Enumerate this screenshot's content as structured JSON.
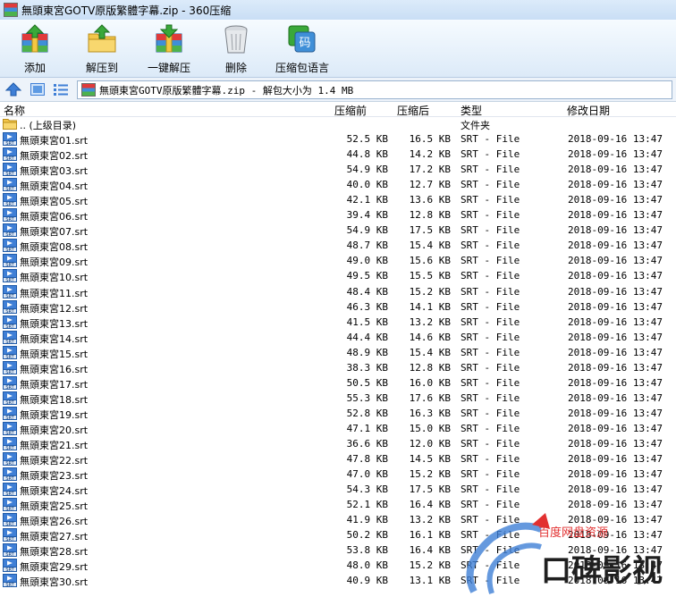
{
  "window": {
    "title": "無頭東宮GOTV原版繁體字幕.zip - 360压缩"
  },
  "toolbar": {
    "add_label": "添加",
    "extract_to_label": "解压到",
    "one_click_extract_label": "一键解压",
    "delete_label": "删除",
    "language_label": "压缩包语言",
    "language_icon_glyph": "码"
  },
  "address": {
    "path": "無頭東宮GOTV原版繁體字幕.zip - 解包大小为 1.4 MB"
  },
  "columns": {
    "name": "名称",
    "compressed_before": "压缩前",
    "compressed_after": "压缩后",
    "type": "类型",
    "modified": "修改日期"
  },
  "parent_row": {
    "name": ".. (上级目录)",
    "type": "文件夹"
  },
  "icons": {
    "srt_label": "SRT"
  },
  "files": [
    {
      "name": "無頭東宮01.srt",
      "before": "52.5 KB",
      "after": "16.5 KB",
      "type": "SRT - File",
      "date": "2018-09-16 13:47"
    },
    {
      "name": "無頭東宮02.srt",
      "before": "44.8 KB",
      "after": "14.2 KB",
      "type": "SRT - File",
      "date": "2018-09-16 13:47"
    },
    {
      "name": "無頭東宮03.srt",
      "before": "54.9 KB",
      "after": "17.2 KB",
      "type": "SRT - File",
      "date": "2018-09-16 13:47"
    },
    {
      "name": "無頭東宮04.srt",
      "before": "40.0 KB",
      "after": "12.7 KB",
      "type": "SRT - File",
      "date": "2018-09-16 13:47"
    },
    {
      "name": "無頭東宮05.srt",
      "before": "42.1 KB",
      "after": "13.6 KB",
      "type": "SRT - File",
      "date": "2018-09-16 13:47"
    },
    {
      "name": "無頭東宮06.srt",
      "before": "39.4 KB",
      "after": "12.8 KB",
      "type": "SRT - File",
      "date": "2018-09-16 13:47"
    },
    {
      "name": "無頭東宮07.srt",
      "before": "54.9 KB",
      "after": "17.5 KB",
      "type": "SRT - File",
      "date": "2018-09-16 13:47"
    },
    {
      "name": "無頭東宮08.srt",
      "before": "48.7 KB",
      "after": "15.4 KB",
      "type": "SRT - File",
      "date": "2018-09-16 13:47"
    },
    {
      "name": "無頭東宮09.srt",
      "before": "49.0 KB",
      "after": "15.6 KB",
      "type": "SRT - File",
      "date": "2018-09-16 13:47"
    },
    {
      "name": "無頭東宮10.srt",
      "before": "49.5 KB",
      "after": "15.5 KB",
      "type": "SRT - File",
      "date": "2018-09-16 13:47"
    },
    {
      "name": "無頭東宮11.srt",
      "before": "48.4 KB",
      "after": "15.2 KB",
      "type": "SRT - File",
      "date": "2018-09-16 13:47"
    },
    {
      "name": "無頭東宮12.srt",
      "before": "46.3 KB",
      "after": "14.1 KB",
      "type": "SRT - File",
      "date": "2018-09-16 13:47"
    },
    {
      "name": "無頭東宮13.srt",
      "before": "41.5 KB",
      "after": "13.2 KB",
      "type": "SRT - File",
      "date": "2018-09-16 13:47"
    },
    {
      "name": "無頭東宮14.srt",
      "before": "44.4 KB",
      "after": "14.6 KB",
      "type": "SRT - File",
      "date": "2018-09-16 13:47"
    },
    {
      "name": "無頭東宮15.srt",
      "before": "48.9 KB",
      "after": "15.4 KB",
      "type": "SRT - File",
      "date": "2018-09-16 13:47"
    },
    {
      "name": "無頭東宮16.srt",
      "before": "38.3 KB",
      "after": "12.8 KB",
      "type": "SRT - File",
      "date": "2018-09-16 13:47"
    },
    {
      "name": "無頭東宮17.srt",
      "before": "50.5 KB",
      "after": "16.0 KB",
      "type": "SRT - File",
      "date": "2018-09-16 13:47"
    },
    {
      "name": "無頭東宮18.srt",
      "before": "55.3 KB",
      "after": "17.6 KB",
      "type": "SRT - File",
      "date": "2018-09-16 13:47"
    },
    {
      "name": "無頭東宮19.srt",
      "before": "52.8 KB",
      "after": "16.3 KB",
      "type": "SRT - File",
      "date": "2018-09-16 13:47"
    },
    {
      "name": "無頭東宮20.srt",
      "before": "47.1 KB",
      "after": "15.0 KB",
      "type": "SRT - File",
      "date": "2018-09-16 13:47"
    },
    {
      "name": "無頭東宮21.srt",
      "before": "36.6 KB",
      "after": "12.0 KB",
      "type": "SRT - File",
      "date": "2018-09-16 13:47"
    },
    {
      "name": "無頭東宮22.srt",
      "before": "47.8 KB",
      "after": "14.5 KB",
      "type": "SRT - File",
      "date": "2018-09-16 13:47"
    },
    {
      "name": "無頭東宮23.srt",
      "before": "47.0 KB",
      "after": "15.2 KB",
      "type": "SRT - File",
      "date": "2018-09-16 13:47"
    },
    {
      "name": "無頭東宮24.srt",
      "before": "54.3 KB",
      "after": "17.5 KB",
      "type": "SRT - File",
      "date": "2018-09-16 13:47"
    },
    {
      "name": "無頭東宮25.srt",
      "before": "52.1 KB",
      "after": "16.4 KB",
      "type": "SRT - File",
      "date": "2018-09-16 13:47"
    },
    {
      "name": "無頭東宮26.srt",
      "before": "41.9 KB",
      "after": "13.2 KB",
      "type": "SRT - File",
      "date": "2018-09-16 13:47"
    },
    {
      "name": "無頭東宮27.srt",
      "before": "50.2 KB",
      "after": "16.1 KB",
      "type": "SRT - File",
      "date": "2018-09-16 13:47"
    },
    {
      "name": "無頭東宮28.srt",
      "before": "53.8 KB",
      "after": "16.4 KB",
      "type": "SRT - File",
      "date": "2018-09-16 13:47"
    },
    {
      "name": "無頭東宮29.srt",
      "before": "48.0 KB",
      "after": "15.2 KB",
      "type": "SRT - File",
      "date": "2018-09-16 13:47"
    },
    {
      "name": "無頭東宮30.srt",
      "before": "40.9 KB",
      "after": "13.1 KB",
      "type": "SRT - File",
      "date": "2018-09-16 13:47"
    }
  ],
  "watermark": {
    "small_text": "百度网盘资源",
    "large_text": "口碑影视"
  },
  "colors": {
    "accent": "#3f7fd6",
    "watermark_red": "#e23030"
  }
}
